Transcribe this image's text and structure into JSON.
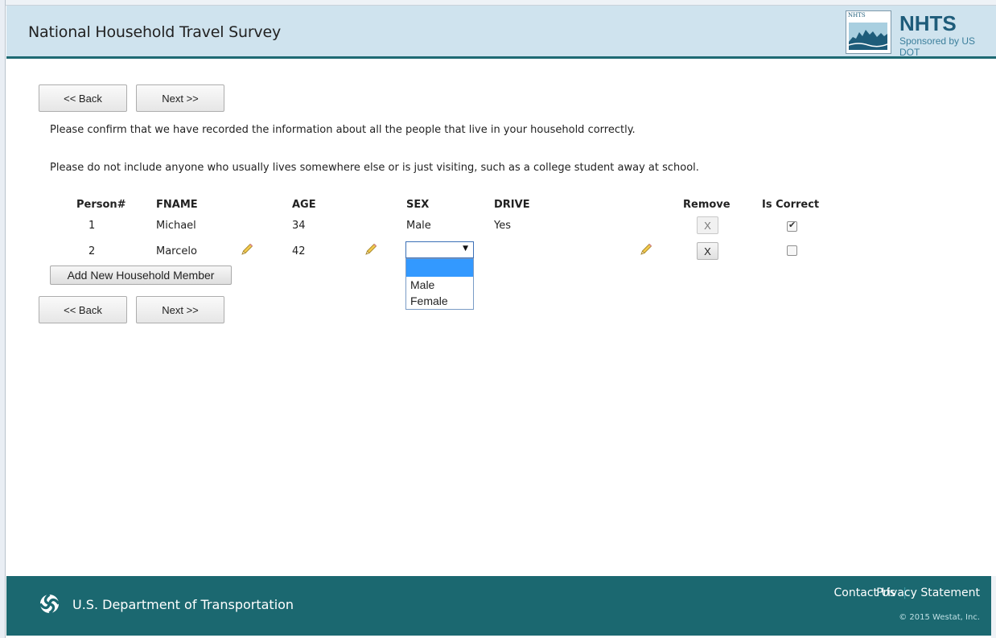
{
  "header": {
    "title": "National Household Travel Survey",
    "logo_mini": "NHTS",
    "logo_name": "NHTS",
    "logo_sub": "Sponsored by US DOT"
  },
  "nav": {
    "back_label": "<< Back",
    "next_label": "Next >>"
  },
  "instructions": {
    "line1": "Please confirm that we have recorded the information about all the people that live in your household correctly.",
    "line2": "Please do not include anyone who usually lives somewhere else or is just visiting, such as a college student away at school."
  },
  "table": {
    "headers": {
      "person": "Person#",
      "fname": "FNAME",
      "age": "AGE",
      "sex": "SEX",
      "drive": "DRIVE",
      "remove": "Remove",
      "correct": "Is Correct"
    },
    "rows": [
      {
        "person": "1",
        "fname": "Michael",
        "age": "34",
        "sex": "Male",
        "drive": "Yes",
        "remove": "X",
        "correct": true
      },
      {
        "person": "2",
        "fname": "Marcelo",
        "age": "42",
        "sex": "",
        "drive": "",
        "remove": "X",
        "correct": false
      }
    ]
  },
  "sex_dropdown": {
    "selected": "",
    "options": [
      "",
      "Male",
      "Female"
    ]
  },
  "add_member_label": "Add New Household Member",
  "footer": {
    "dept": "U.S. Department of Transportation",
    "contact": "Contact Us",
    "separator": "|",
    "privacy": "Privacy Statement",
    "copyright": "© 2015 Westat, Inc."
  },
  "colors": {
    "header_bg": "#cfe3ee",
    "accent": "#1e6a73",
    "footer_bg": "#1b6870",
    "select_highlight": "#3399ff"
  },
  "icons": [
    "pencil-icon",
    "dot-logo-icon",
    "nhts-logo-icon",
    "checkmark-icon",
    "dropdown-arrow-icon"
  ]
}
